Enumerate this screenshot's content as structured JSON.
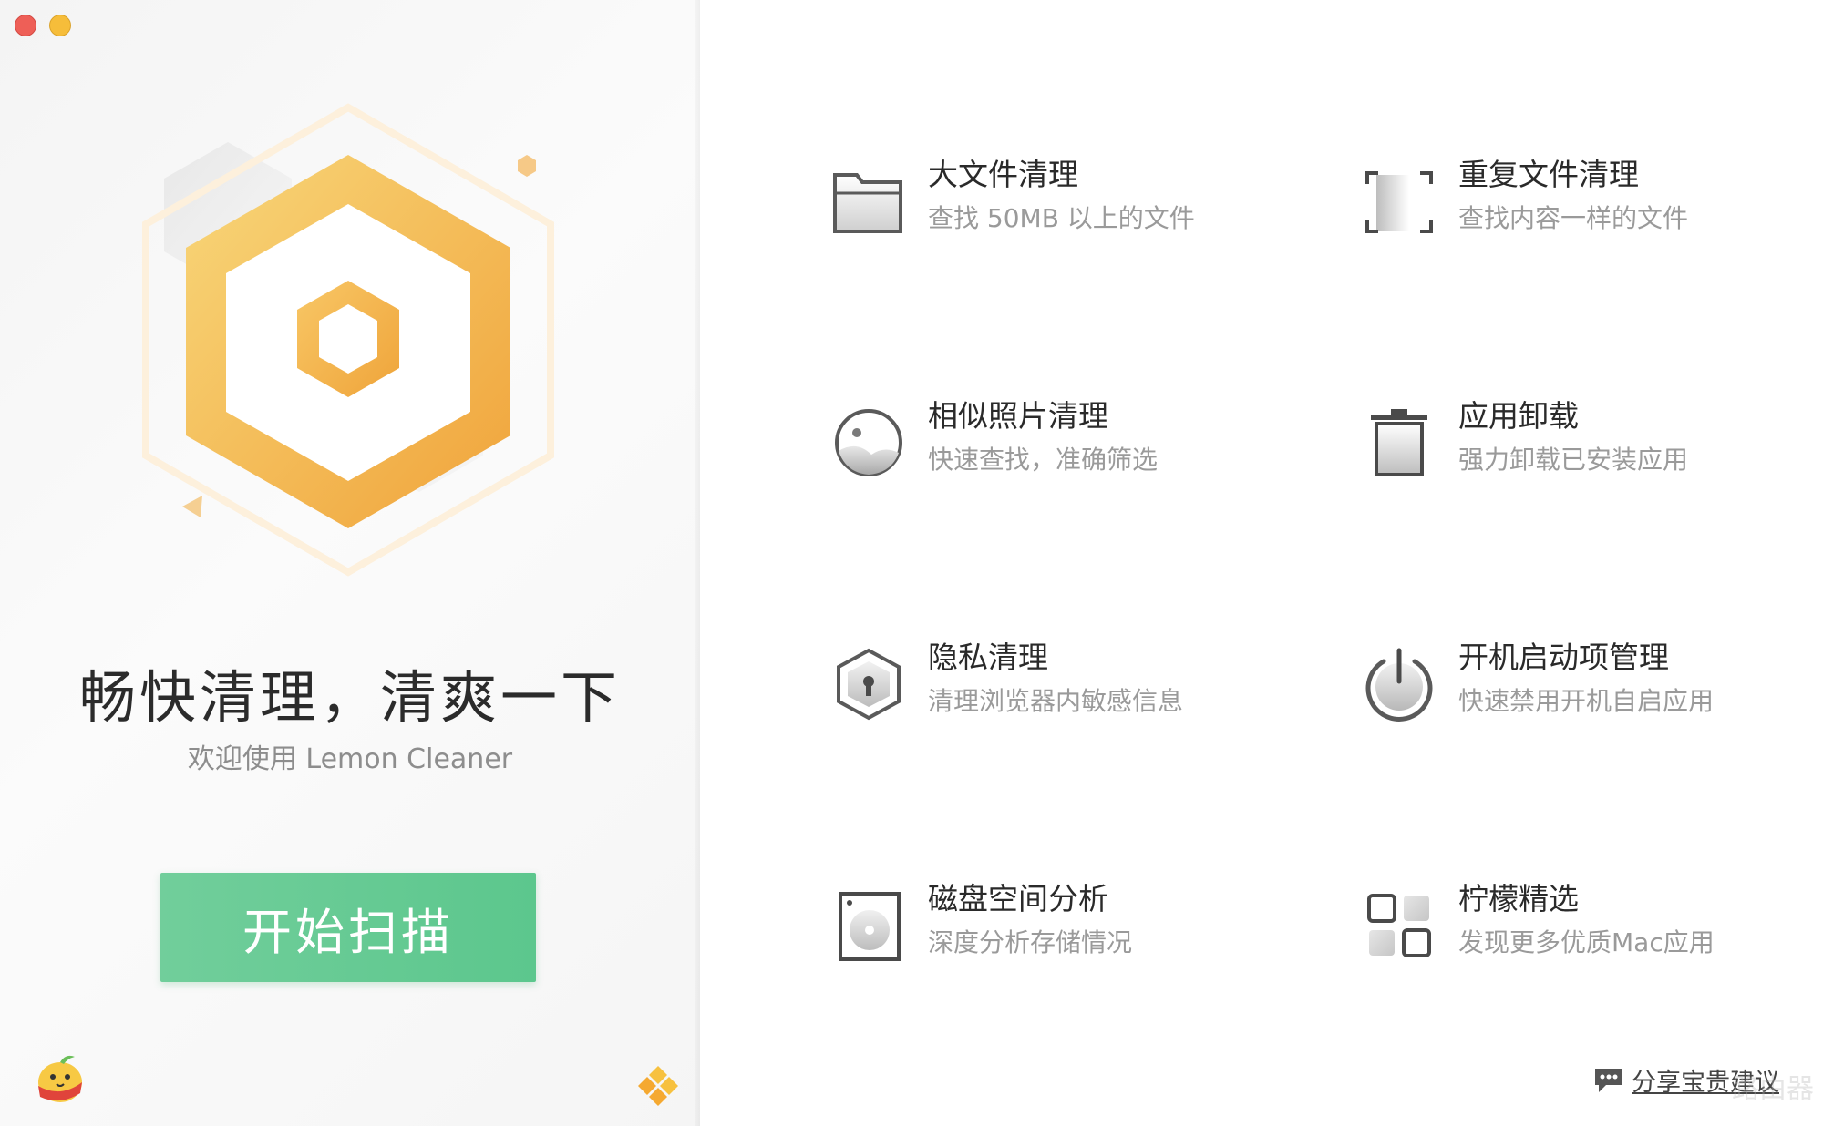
{
  "window": {
    "traffic_lights": [
      "close",
      "minimize"
    ]
  },
  "left": {
    "slogan": "畅快清理，清爽一下",
    "welcome": "欢迎使用 Lemon Cleaner",
    "scan_button": "开始扫描"
  },
  "features": [
    {
      "title": "大文件清理",
      "desc": "查找 50MB 以上的文件",
      "icon": "large-file-folder-icon"
    },
    {
      "title": "重复文件清理",
      "desc": "查找内容一样的文件",
      "icon": "duplicate-file-icon"
    },
    {
      "title": "相似照片清理",
      "desc": "快速查找，准确筛选",
      "icon": "similar-photo-icon"
    },
    {
      "title": "应用卸载",
      "desc": "强力卸载已安装应用",
      "icon": "trash-icon"
    },
    {
      "title": "隐私清理",
      "desc": "清理浏览器内敏感信息",
      "icon": "privacy-shield-icon"
    },
    {
      "title": "开机启动项管理",
      "desc": "快速禁用开机自启应用",
      "icon": "power-icon"
    },
    {
      "title": "磁盘空间分析",
      "desc": "深度分析存储情况",
      "icon": "disk-icon"
    },
    {
      "title": "柠檬精选",
      "desc": "发现更多优质Mac应用",
      "icon": "app-grid-icon"
    }
  ],
  "footer": {
    "feedback": "分享宝贵建议",
    "watermark": "路由器"
  },
  "colors": {
    "accent_green": "#5cc78d",
    "hex_orange": "#f2ab3c",
    "text_dark": "#2a2a2a",
    "text_gray": "#9a9a9a"
  }
}
